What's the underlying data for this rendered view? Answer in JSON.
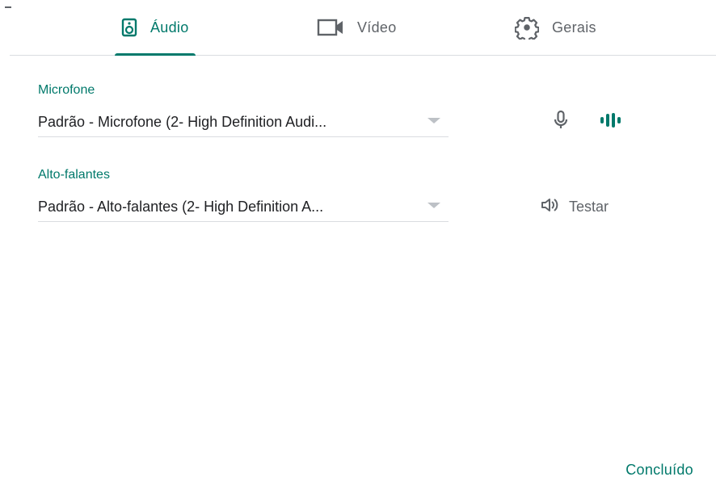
{
  "tabs": [
    {
      "label": "Áudio",
      "icon": "speaker-icon",
      "active": true
    },
    {
      "label": "Vídeo",
      "icon": "video-camera-icon",
      "active": false
    },
    {
      "label": "Gerais",
      "icon": "gear-icon",
      "active": false
    }
  ],
  "microphone": {
    "label": "Microfone",
    "selected": "Padrão - Microfone (2- High Definition Audi..."
  },
  "speakers": {
    "label": "Alto-falantes",
    "selected": "Padrão - Alto-falantes (2- High Definition A...",
    "test_label": "Testar"
  },
  "footer": {
    "done_label": "Concluído"
  },
  "colors": {
    "accent": "#00796b",
    "text": "#202124",
    "muted": "#5f6368",
    "divider": "#dadce0"
  }
}
